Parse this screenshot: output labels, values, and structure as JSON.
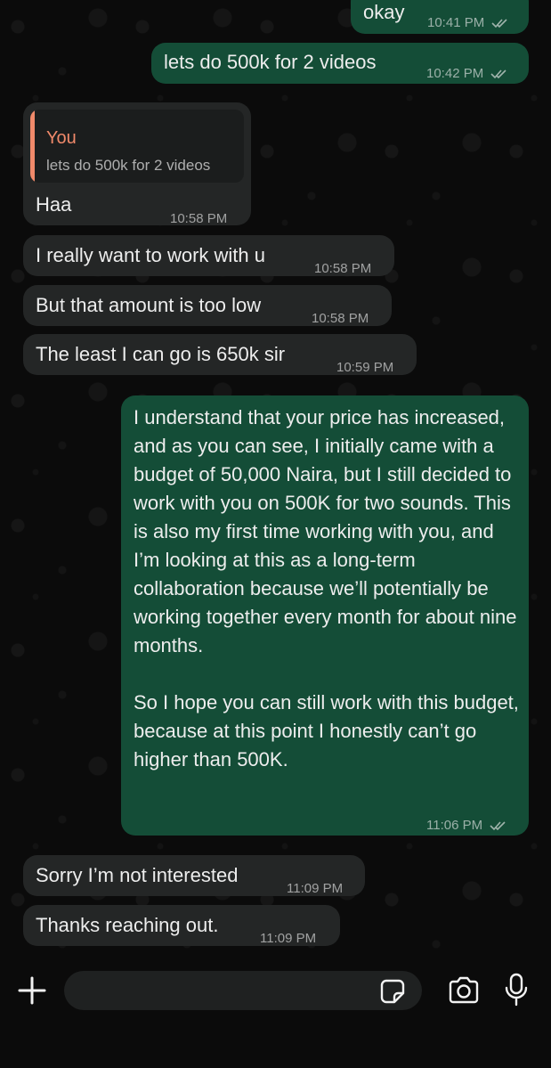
{
  "messages": [
    {
      "direction": "out",
      "text": "okay",
      "time": "10:41 PM",
      "status": "read"
    },
    {
      "direction": "out",
      "text": "lets do 500k for 2 videos",
      "time": "10:42 PM",
      "status": "read"
    },
    {
      "direction": "in",
      "text": "Haa",
      "time": "10:58 PM",
      "quoted": {
        "author": "You",
        "text": "lets do 500k for 2 videos"
      }
    },
    {
      "direction": "in",
      "text": "I really want to work with u",
      "time": "10:58 PM"
    },
    {
      "direction": "in",
      "text": "But that amount is too low",
      "time": "10:58 PM"
    },
    {
      "direction": "in",
      "text": "The least I can go is 650k sir",
      "time": "10:59 PM"
    },
    {
      "direction": "out",
      "paragraphs": [
        "I understand that your price has increased, and as you can see, I initially came with a budget of 50,000 Naira, but I still decided to work with you on 500K for two sounds. This is also my first time working with you, and I’m looking at this as a long-term collaboration because we’ll potentially be working together every month for about nine months.",
        "So I hope you can still work with this budget, because at this point I honestly can’t go higher than 500K."
      ],
      "time": "11:06 PM",
      "status": "read"
    },
    {
      "direction": "in",
      "text": "Sorry I’m not interested",
      "time": "11:09 PM"
    },
    {
      "direction": "in",
      "text": "Thanks reaching out.",
      "time": "11:09 PM"
    }
  ],
  "composer": {
    "value": "",
    "placeholder": ""
  },
  "icons": {
    "attach": "plus-icon",
    "sticker": "sticker-icon",
    "camera": "camera-icon",
    "mic": "microphone-icon",
    "read_receipt": "double-check-icon"
  },
  "colors": {
    "background": "#0b0b0b",
    "incoming_bubble": "#242626",
    "outgoing_bubble": "#144d37",
    "quote_accent": "#f0896a"
  }
}
